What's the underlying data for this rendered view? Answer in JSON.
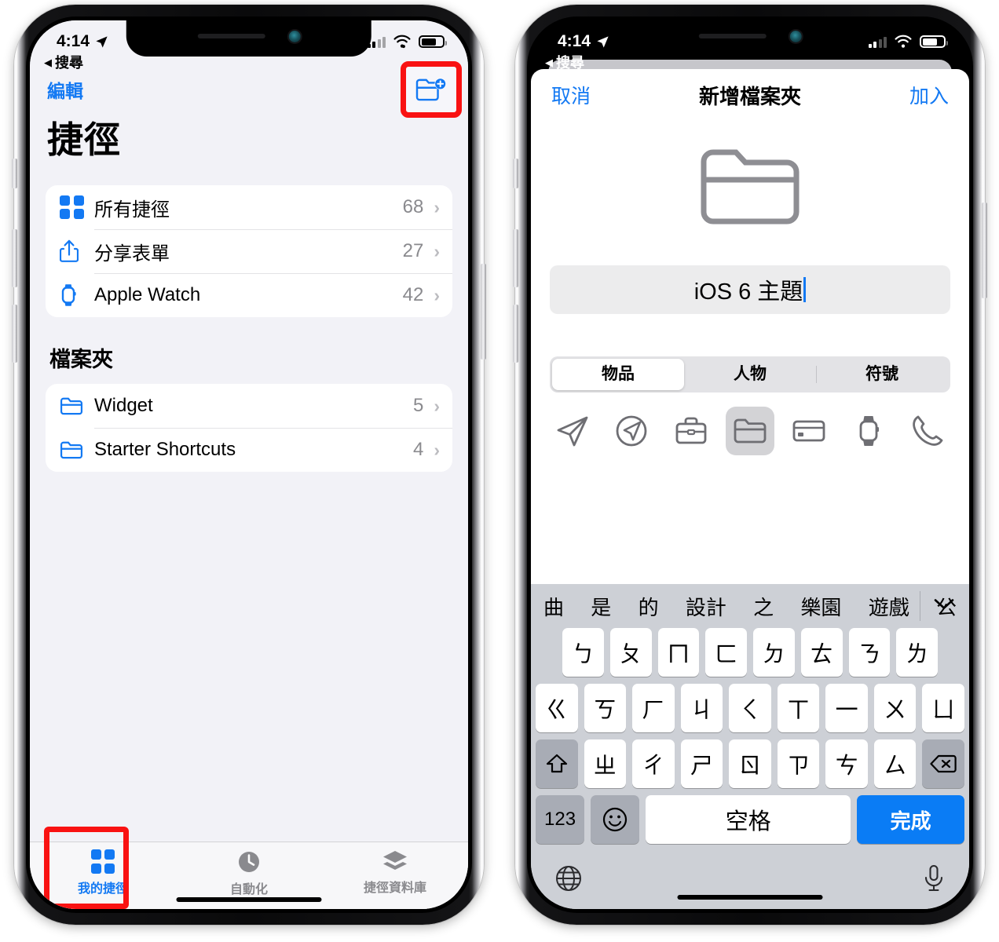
{
  "left_phone": {
    "status_bar": {
      "time": "4:14",
      "location_icon": "location-arrow-icon",
      "wifi_icon": "wifi-icon",
      "battery_icon": "battery-icon",
      "signal_icon": "cellular-signal-icon"
    },
    "back_label": "搜尋",
    "nav": {
      "edit_label": "編輯",
      "new_folder_icon": "folder-plus-icon"
    },
    "title": "捷徑",
    "list": [
      {
        "icon": "grid-squares-icon",
        "label": "所有捷徑",
        "count": "68",
        "chevron": "›"
      },
      {
        "icon": "share-sheet-icon",
        "label": "分享表單",
        "count": "27",
        "chevron": "›"
      },
      {
        "icon": "apple-watch-icon",
        "label": "Apple Watch",
        "count": "42",
        "chevron": "›"
      }
    ],
    "section_header": "檔案夾",
    "folders": [
      {
        "icon": "folder-icon",
        "label": "Widget",
        "count": "5",
        "chevron": "›"
      },
      {
        "icon": "folder-icon",
        "label": "Starter Shortcuts",
        "count": "4",
        "chevron": "›"
      }
    ],
    "tabs": [
      {
        "icon": "grid-squares-icon",
        "label": "我的捷徑",
        "active": true
      },
      {
        "icon": "clock-automation-icon",
        "label": "自動化",
        "active": false
      },
      {
        "icon": "layers-gallery-icon",
        "label": "捷徑資料庫",
        "active": false
      }
    ]
  },
  "right_phone": {
    "status_bar": {
      "time": "4:14",
      "location_icon": "location-arrow-icon",
      "wifi_icon": "wifi-icon",
      "battery_icon": "battery-icon",
      "signal_icon": "cellular-signal-icon"
    },
    "back_label": "搜尋",
    "modal": {
      "cancel_label": "取消",
      "title": "新增檔案夾",
      "add_label": "加入",
      "preview_icon": "folder-icon",
      "field_value": "iOS 6 主題",
      "segments": [
        {
          "label": "物品",
          "selected": true
        },
        {
          "label": "人物",
          "selected": false
        },
        {
          "label": "符號",
          "selected": false
        }
      ],
      "glyphs": [
        {
          "icon": "paper-plane-icon",
          "selected": false
        },
        {
          "icon": "compass-icon",
          "selected": false
        },
        {
          "icon": "briefcase-icon",
          "selected": false
        },
        {
          "icon": "folder-icon",
          "selected": true
        },
        {
          "icon": "credit-card-icon",
          "selected": false
        },
        {
          "icon": "apple-watch-icon",
          "selected": false
        },
        {
          "icon": "phone-icon",
          "selected": false
        }
      ]
    },
    "keyboard": {
      "suggestions": [
        "曲",
        "是",
        "的",
        "設計",
        "之",
        "樂園",
        "遊戲",
        "公"
      ],
      "collapse_icon": "chevron-down-icon",
      "row1": [
        "ㄅ",
        "ㄆ",
        "ㄇ",
        "ㄈ",
        "ㄉ",
        "ㄊ",
        "ㄋ",
        "ㄌ"
      ],
      "row2": [
        "ㄍ",
        "ㄎ",
        "ㄏ",
        "ㄐ",
        "ㄑ",
        "ㄒ",
        "一",
        "ㄨ",
        "ㄩ"
      ],
      "row3_shift_icon": "shift-up-icon",
      "row3": [
        "ㄓ",
        "ㄔ",
        "ㄕ",
        "ㄖ",
        "ㄗ",
        "ㄘ",
        "ㄙ"
      ],
      "row3_delete_icon": "backspace-icon",
      "numbers_label": "123",
      "emoji_icon": "smiley-face-icon",
      "space_label": "空格",
      "done_label": "完成",
      "globe_icon": "globe-icon",
      "mic_icon": "microphone-icon"
    }
  },
  "colors": {
    "accent_blue": "#1379f3",
    "highlight_red": "#f91212",
    "key_blue": "#0a7cf5",
    "gray_text": "#8a8a8e"
  }
}
